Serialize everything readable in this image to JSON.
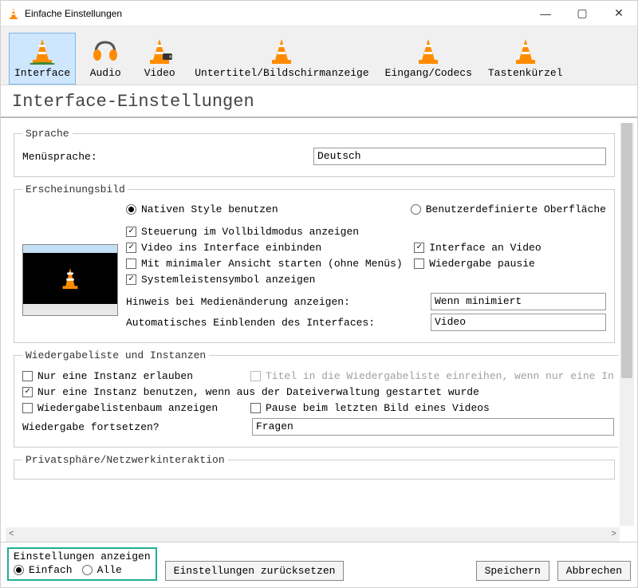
{
  "window": {
    "title": "Einfache Einstellungen"
  },
  "tabs": [
    {
      "label": "Interface"
    },
    {
      "label": "Audio"
    },
    {
      "label": "Video"
    },
    {
      "label": "Untertitel/Bildschirmanzeige"
    },
    {
      "label": "Eingang/Codecs"
    },
    {
      "label": "Tastenkürzel"
    }
  ],
  "pageTitle": "Interface-Einstellungen",
  "language": {
    "legend": "Sprache",
    "menuLabel": "Menüsprache:",
    "value": "Deutsch"
  },
  "appearance": {
    "legend": "Erscheinungsbild",
    "nativeStyle": "Nativen Style benutzen",
    "customUI": "Benutzerdefinierte Oberfläche",
    "fullscreenControl": "Steuerung im Vollbildmodus anzeigen",
    "embedVideo": "Video ins Interface einbinden",
    "interfaceToVideo": "Interface an Video",
    "minimalView": "Mit minimaler Ansicht starten (ohne Menüs)",
    "pausePlayback": "Wiedergabe pausie",
    "systray": "Systemleistensymbol anzeigen",
    "mediaChangeLabel": "Hinweis bei Medienänderung anzeigen:",
    "mediaChangeValue": "Wenn minimiert",
    "autoRaiseLabel": "Automatisches Einblenden des Interfaces:",
    "autoRaiseValue": "Video"
  },
  "playlist": {
    "legend": "Wiedergabeliste und Instanzen",
    "oneInstance": "Nur eine Instanz erlauben",
    "enqueue": "Titel in die Wiedergabeliste einreihen, wenn nur eine In",
    "oneFromFM": "Nur eine Instanz benutzen, wenn aus der Dateiverwaltung gestartet wurde",
    "playlistTree": "Wiedergabelistenbaum anzeigen",
    "pauseLastFrame": "Pause beim letzten Bild eines Videos",
    "continueLabel": "Wiedergabe fortsetzen?",
    "continueValue": "Fragen"
  },
  "privacyLegend": "Privatsphäre/Netzwerkinteraktion",
  "bottom": {
    "showLabel": "Einstellungen anzeigen",
    "simple": "Einfach",
    "all": "Alle",
    "reset": "Einstellungen zurücksetzen",
    "save": "Speichern",
    "cancel": "Abbrechen"
  }
}
